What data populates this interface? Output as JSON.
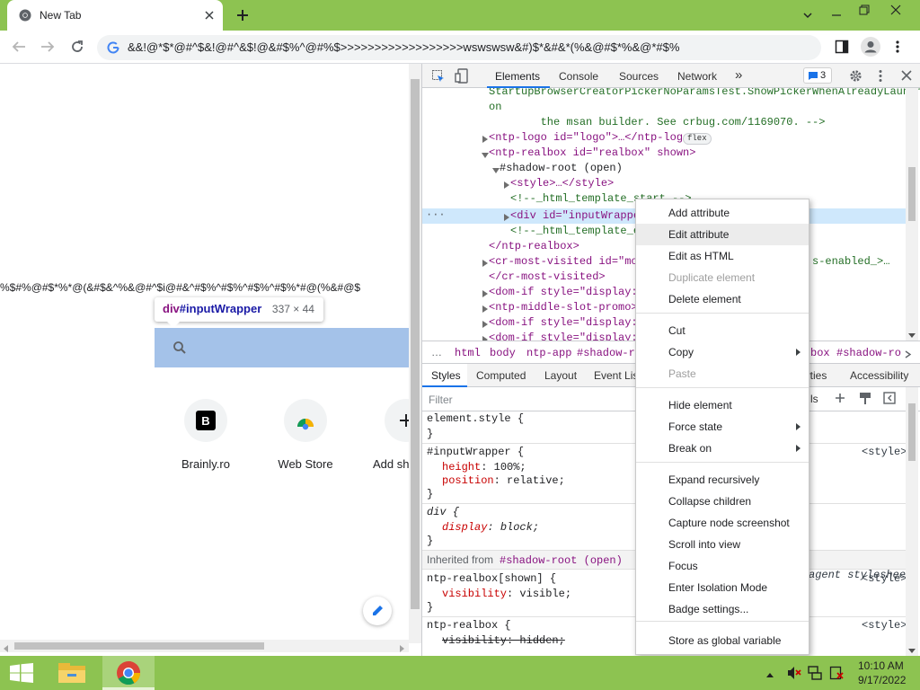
{
  "browser": {
    "tab_title": "New Tab",
    "url": "&&!@*$*@#^$&!@#^&$!@&#$%^@#%$>>>>>>>>>>>>>>>>>>wswswsw&#)$*&#&*(%&@#$*%&@*#$%"
  },
  "page": {
    "bg_text": "%$#%@#$*%*@(&#$&^%&@#^$i@#&^#$%^#$%^#$%^#$%*#@(%&#@$",
    "tooltip_selector_tag": "div",
    "tooltip_selector_id": "#inputWrapper",
    "tooltip_size": "337 × 44",
    "shortcuts": [
      {
        "label": "Brainly.ro",
        "icon": "brainly-icon"
      },
      {
        "label": "Web Store",
        "icon": "chrome-web-store-icon"
      },
      {
        "label": "Add sh",
        "icon": "add-icon"
      }
    ]
  },
  "devtools": {
    "tabs": [
      "Elements",
      "Console",
      "Sources",
      "Network"
    ],
    "more_tabs": "»",
    "issues_count": "3",
    "elements_lines": [
      "StartupBrowserCreatorPickerNoParamsTest.ShowPickerWhenAlreadyLaunched",
      "on",
      "        the msan builder. See crbug.com/1169070. -->",
      "<ntp-logo id=\"logo\">…</ntp-logo>",
      "<ntp-realbox id=\"realbox\" shown>",
      "#shadow-root (open)",
      "<style>…</style>",
      "<!--_html_template_start_-->",
      "<div id=\"inputWrapper",
      "<!--_html_template_en",
      "</ntp-realbox>",
      "<cr-most-visited id=\"most",
      "</cr-most-visited>",
      "<dom-if style=\"display: n",
      "<ntp-middle-slot-promo>…<",
      "<dom-if style=\"display: n",
      "<dom-if style=\"display: n"
    ],
    "elements_tail_fragment": "s-enabled_>…",
    "flex_badge": "flex",
    "breadcrumbs": [
      "html",
      "body",
      "ntp-app",
      "#shadow-ro",
      "box",
      "#shadow-ro"
    ],
    "style_tabs": [
      "Styles",
      "Computed",
      "Layout",
      "Event Lis",
      "erties",
      "Accessibility"
    ],
    "filter_placeholder": "Filter",
    "filter_right_fragment": "ls",
    "styles": {
      "element_style": "element.style {",
      "close": "}",
      "rule1_selector": "#inputWrapper {",
      "rule1_source": "<style>",
      "rule1_props": [
        [
          "height",
          "100%;"
        ],
        [
          "position",
          "relative;"
        ]
      ],
      "rule2_selector": "div {",
      "rule2_source": "agent stylesheet",
      "rule2_props": [
        [
          "display",
          "block;"
        ]
      ],
      "inherited_label": "Inherited from",
      "inherited_node": "#shadow-root (open)",
      "rule3_selector": "ntp-realbox[shown] {",
      "rule3_source": "<style>",
      "rule3_props": [
        [
          "visibility",
          "visible;"
        ]
      ],
      "rule4_selector": "ntp-realbox {",
      "rule4_source": "<style>",
      "rule4_props": [
        [
          "visibility",
          "hidden;"
        ]
      ]
    }
  },
  "context_menu": {
    "items": [
      {
        "label": "Add attribute",
        "disabled": false
      },
      {
        "label": "Edit attribute",
        "disabled": false,
        "highlighted": true
      },
      {
        "label": "Edit as HTML",
        "disabled": false
      },
      {
        "label": "Duplicate element",
        "disabled": true
      },
      {
        "label": "Delete element",
        "disabled": false
      },
      {
        "label": "Cut",
        "disabled": false
      },
      {
        "label": "Copy",
        "disabled": false,
        "submenu": true
      },
      {
        "label": "Paste",
        "disabled": true
      },
      {
        "label": "Hide element",
        "disabled": false
      },
      {
        "label": "Force state",
        "disabled": false,
        "submenu": true
      },
      {
        "label": "Break on",
        "disabled": false,
        "submenu": true
      },
      {
        "label": "Expand recursively",
        "disabled": false
      },
      {
        "label": "Collapse children",
        "disabled": false
      },
      {
        "label": "Capture node screenshot",
        "disabled": false
      },
      {
        "label": "Scroll into view",
        "disabled": false
      },
      {
        "label": "Focus",
        "disabled": false
      },
      {
        "label": "Enter Isolation Mode",
        "disabled": false
      },
      {
        "label": "Badge settings...",
        "disabled": false
      },
      {
        "label": "Store as global variable",
        "disabled": false
      }
    ]
  },
  "taskbar": {
    "time": "10:10 AM",
    "date": "9/17/2022"
  },
  "colors": {
    "frame": "#8dc351",
    "selected_node_bg": "#cfe8fc",
    "inspect_highlight": "#a4c2e9",
    "accent": "#1a73e8"
  }
}
